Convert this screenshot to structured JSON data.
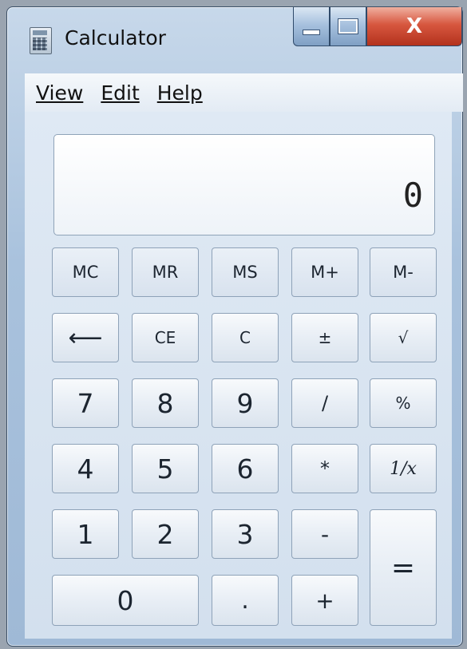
{
  "window": {
    "title": "Calculator",
    "close_label": "X"
  },
  "menu": [
    {
      "name": "menu-view",
      "label": "View"
    },
    {
      "name": "menu-edit",
      "label": "Edit"
    },
    {
      "name": "menu-help",
      "label": "Help"
    }
  ],
  "display": {
    "value": "0"
  },
  "keys": {
    "mc": "MC",
    "mr": "MR",
    "ms": "MS",
    "mplus": "M+",
    "mminus": "M-",
    "back": "⟵",
    "ce": "CE",
    "c": "C",
    "plusminus": "±",
    "sqrt": "√",
    "k7": "7",
    "k8": "8",
    "k9": "9",
    "divide": "/",
    "percent": "%",
    "k4": "4",
    "k5": "5",
    "k6": "6",
    "multiply": "*",
    "reciprocal": "1/x",
    "k1": "1",
    "k2": "2",
    "k3": "3",
    "minus": "-",
    "equals": "=",
    "k0": "0",
    "decimal": ".",
    "plus": "+"
  },
  "colors": {
    "close": "#c8432b",
    "frame": "#a9c2dd"
  }
}
